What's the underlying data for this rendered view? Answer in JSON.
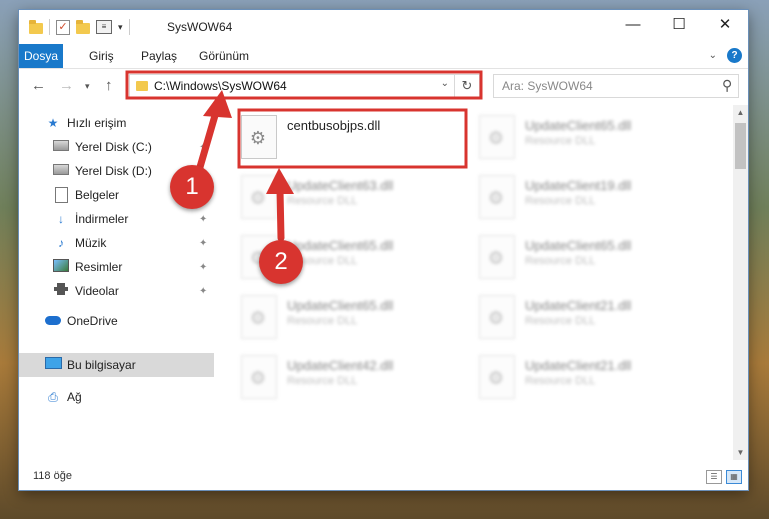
{
  "window": {
    "title": "SysWOW64",
    "controls": {
      "minimize": "—",
      "maximize": "☐",
      "close": "✕"
    }
  },
  "ribbon": {
    "tabs": [
      {
        "label": "Dosya",
        "active": true
      },
      {
        "label": "Giriş"
      },
      {
        "label": "Paylaş"
      },
      {
        "label": "Görünüm"
      }
    ],
    "help": "?"
  },
  "nav": {
    "address": "C:\\Windows\\SysWOW64",
    "search_placeholder": "Ara: SysWOW64"
  },
  "sidebar": {
    "items": [
      {
        "label": "Hızlı erişim",
        "icon": "star-icon"
      },
      {
        "label": "Yerel Disk (C:)",
        "icon": "drive-icon",
        "pinned": true
      },
      {
        "label": "Yerel Disk (D:)",
        "icon": "drive-icon",
        "pinned": true
      },
      {
        "label": "Belgeler",
        "icon": "document-icon",
        "pinned": true
      },
      {
        "label": "İndirmeler",
        "icon": "download-icon",
        "pinned": true
      },
      {
        "label": "Müzik",
        "icon": "music-icon",
        "pinned": true
      },
      {
        "label": "Resimler",
        "icon": "picture-icon",
        "pinned": true
      },
      {
        "label": "Videolar",
        "icon": "video-icon",
        "pinned": true
      },
      {
        "label": "OneDrive",
        "icon": "cloud-icon"
      },
      {
        "label": "Bu bilgisayar",
        "icon": "computer-icon",
        "selected": true
      },
      {
        "label": "Ağ",
        "icon": "network-icon"
      }
    ]
  },
  "files": [
    {
      "name": "centbusobjps.dll",
      "type": "",
      "highlighted": true
    },
    {
      "name": "UpdateClient65.dll",
      "type": "Resource DLL"
    },
    {
      "name": "UpdateClient63.dll",
      "type": "Resource DLL"
    },
    {
      "name": "UpdateClient19.dll",
      "type": "Resource DLL"
    },
    {
      "name": "UpdateClient65.dll",
      "type": "Resource DLL"
    },
    {
      "name": "UpdateClient65.dll",
      "type": "Resource DLL"
    },
    {
      "name": "UpdateClient65.dll",
      "type": "Resource DLL"
    },
    {
      "name": "UpdateClient21.dll",
      "type": "Resource DLL"
    },
    {
      "name": "UpdateClient42.dll",
      "type": "Resource DLL"
    },
    {
      "name": "UpdateClient21.dll",
      "type": "Resource DLL"
    }
  ],
  "status": {
    "count": "118 öğe"
  },
  "annotations": {
    "badge1": "1",
    "badge2": "2",
    "color": "#d8342f"
  }
}
